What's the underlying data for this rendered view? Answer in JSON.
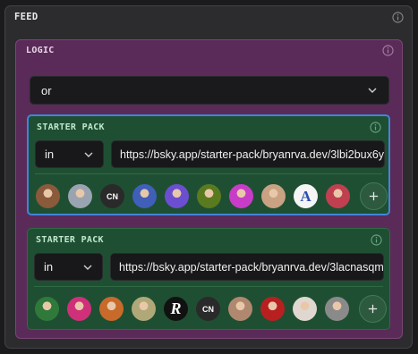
{
  "feed": {
    "title": "FEED"
  },
  "logic": {
    "title": "LOGIC",
    "operator": "or"
  },
  "starter_packs": [
    {
      "title": "STARTER PACK",
      "operator": "in",
      "url": "https://bsky.app/starter-pack/bryanrva.dev/3lbi2bux6y",
      "avatars": [
        {
          "kind": "photo",
          "color": "#8a5a3a",
          "label": ""
        },
        {
          "kind": "photo",
          "color": "#9aa4b0",
          "label": ""
        },
        {
          "kind": "text",
          "color": "#2a2a2a",
          "label": "CN"
        },
        {
          "kind": "photo",
          "color": "#3f5fb8",
          "label": ""
        },
        {
          "kind": "photo",
          "color": "#6b4fd0",
          "label": ""
        },
        {
          "kind": "photo",
          "color": "#5a7a20",
          "label": ""
        },
        {
          "kind": "photo",
          "color": "#c83cc8",
          "label": ""
        },
        {
          "kind": "photo",
          "color": "#c8a282",
          "label": ""
        },
        {
          "kind": "text",
          "color": "#f5f5f5",
          "label": "A"
        },
        {
          "kind": "photo",
          "color": "#c04050",
          "label": ""
        }
      ],
      "add_label": "+"
    },
    {
      "title": "STARTER PACK",
      "operator": "in",
      "url": "https://bsky.app/starter-pack/bryanrva.dev/3lacnasqm",
      "avatars": [
        {
          "kind": "photo",
          "color": "#2f7a3a",
          "label": ""
        },
        {
          "kind": "photo",
          "color": "#d0307a",
          "label": ""
        },
        {
          "kind": "photo",
          "color": "#c86a2a",
          "label": ""
        },
        {
          "kind": "photo",
          "color": "#b0a878",
          "label": ""
        },
        {
          "kind": "text",
          "color": "#111111",
          "label": "R"
        },
        {
          "kind": "text",
          "color": "#2a2a2a",
          "label": "CN"
        },
        {
          "kind": "photo",
          "color": "#b08870",
          "label": ""
        },
        {
          "kind": "photo",
          "color": "#b82020",
          "label": ""
        },
        {
          "kind": "photo",
          "color": "#e0d8d0",
          "label": ""
        },
        {
          "kind": "photo",
          "color": "#8a8a8a",
          "label": ""
        }
      ],
      "add_label": "+"
    }
  ],
  "icons": {
    "info": "info-icon",
    "chevron": "chevron-down-icon",
    "add": "plus-icon"
  }
}
